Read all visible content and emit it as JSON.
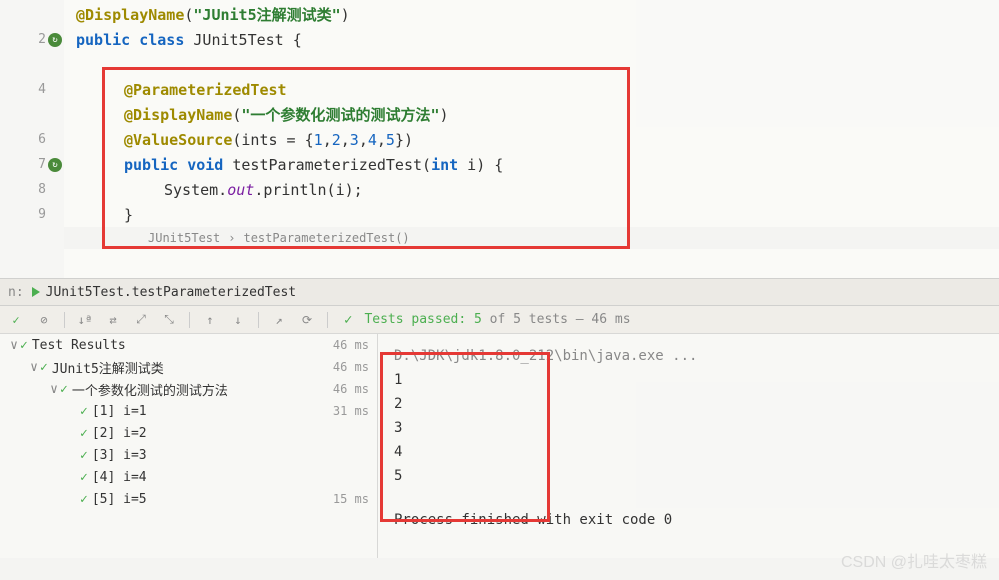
{
  "gutter": {
    "lines": [
      "",
      "2",
      "",
      "4",
      "",
      "6",
      "7",
      "8",
      "9"
    ]
  },
  "code": {
    "l1_anno": "@DisplayName",
    "l1_open": "(",
    "l1_str": "\"JUnit5注解测试类\"",
    "l1_close": ")",
    "l2_public": "public ",
    "l2_class": "class ",
    "l2_name": "JUnit5Test {",
    "l4_anno": "@ParameterizedTest",
    "l5_anno": "@DisplayName",
    "l5_open": "(",
    "l5_str": "\"一个参数化测试的测试方法\"",
    "l5_close": ")",
    "l6_anno": "@ValueSource",
    "l6_open": "(ints = {",
    "l6_n1": "1",
    "l6_c": ",",
    "l6_n2": "2",
    "l6_n3": "3",
    "l6_n4": "4",
    "l6_n5": "5",
    "l6_close": "})",
    "l7_public": "public ",
    "l7_void": "void ",
    "l7_name": "testParameterizedTest(",
    "l7_int": "int",
    "l7_rest": " i) {",
    "l8_sys": "System.",
    "l8_out": "out",
    "l8_print": ".println(i);",
    "l9": "}"
  },
  "breadcrumb": {
    "class": "JUnit5Test",
    "sep": "›",
    "method": "testParameterizedTest()"
  },
  "panel": {
    "label": "n:",
    "tab": "JUnit5Test.testParameterizedTest"
  },
  "toolbar": {
    "check": "✓",
    "fail": "⊘",
    "sort": "↓ª",
    "filter": "⇄",
    "expand": "⤢",
    "collapse": "⤡",
    "up": "↑",
    "down": "↓",
    "export": "↗",
    "history": "⟳",
    "summary_passed": "Tests passed: 5",
    "summary_rest": " of 5 tests – 46 ms"
  },
  "tree": {
    "root": {
      "label": "Test Results",
      "time": "46 ms"
    },
    "class": {
      "label": "JUnit5注解测试类",
      "time": "46 ms"
    },
    "method": {
      "label": "一个参数化测试的测试方法",
      "time": "46 ms"
    },
    "r1": {
      "label": "[1] i=1",
      "time": "31 ms"
    },
    "r2": {
      "label": "[2] i=2",
      "time": ""
    },
    "r3": {
      "label": "[3] i=3",
      "time": ""
    },
    "r4": {
      "label": "[4] i=4",
      "time": ""
    },
    "r5": {
      "label": "[5] i=5",
      "time": "15 ms"
    }
  },
  "console": {
    "jdk": "D:\\JDK\\jdk1.8.0_212\\bin\\java.exe ...",
    "o1": "1",
    "o2": "2",
    "o3": "3",
    "o4": "4",
    "o5": "5",
    "exit": "Process finished with exit code 0"
  },
  "watermark": "CSDN @扎哇太枣糕"
}
